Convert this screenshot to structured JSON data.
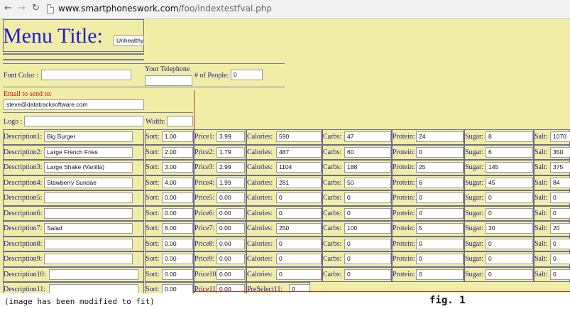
{
  "browser": {
    "url_host": "www.smartphoneswork.com",
    "url_path": "/foo/indextestfval.php"
  },
  "header": {
    "title": "Menu Title:",
    "title_input": "Unhealthy"
  },
  "settings": {
    "font_color_label": "Font Color :",
    "font_color_value": "",
    "telephone_label": "Your Telephone",
    "telephone_value": "",
    "people_label": "# of People:",
    "people_value": "0",
    "email_label": "Email to send to:",
    "email_value": "steve@datatracksoftware.com",
    "logo_label": "Logo :",
    "logo_value": "",
    "width_label": "Width:",
    "width_value": ""
  },
  "rows": [
    {
      "description_label": "Description1:",
      "description": "Big Burger",
      "sort_label": "Sort:",
      "sort": "1.00",
      "price_label": "Price1:",
      "price": "3.99",
      "calories_label": "Calories:",
      "calories": "590",
      "carbs_label": "Carbs:",
      "carbs": "47",
      "protein_label": "Protein:",
      "protein": "24",
      "sugar_label": "Sugar:",
      "sugar": "8",
      "salt_label": "Salt:",
      "salt": "1070"
    },
    {
      "description_label": "Description2:",
      "description": "Large French Fries",
      "sort_label": "Sort:",
      "sort": "2.00",
      "price_label": "Price2:",
      "price": "1.79",
      "calories_label": "Calories:",
      "calories": "487",
      "carbs_label": "Carbs:",
      "carbs": "60",
      "protein_label": "Protein:",
      "protein": "0",
      "sugar_label": "Sugar:",
      "sugar": "6",
      "salt_label": "Salt:",
      "salt": "350"
    },
    {
      "description_label": "Description3:",
      "description": "Large Shake (Vanilla)",
      "sort_label": "Sort:",
      "sort": "3.00",
      "price_label": "Price3:",
      "price": "2.99",
      "calories_label": "Calories:",
      "calories": "1104",
      "carbs_label": "Carbs:",
      "carbs": "188",
      "protein_label": "Protein:",
      "protein": "25",
      "sugar_label": "Sugar:",
      "sugar": "145",
      "salt_label": "Salt:",
      "salt": "375"
    },
    {
      "description_label": "Description4:",
      "description": "Stawberry Sundae",
      "sort_label": "Sort:",
      "sort": "4.00",
      "price_label": "Price4:",
      "price": "1.99",
      "calories_label": "Calories:",
      "calories": "281",
      "carbs_label": "Carbs:",
      "carbs": "50",
      "protein_label": "Protein:",
      "protein": "6",
      "sugar_label": "Sugar:",
      "sugar": "45",
      "salt_label": "Salt:",
      "salt": "84"
    },
    {
      "description_label": "Description5:",
      "description": "",
      "sort_label": "Sort:",
      "sort": "0.00",
      "price_label": "Price5:",
      "price": "0.00",
      "calories_label": "Calories:",
      "calories": "0",
      "carbs_label": "Carbs:",
      "carbs": "0",
      "protein_label": "Protein:",
      "protein": "0",
      "sugar_label": "Sugar:",
      "sugar": "0",
      "salt_label": "Salt:",
      "salt": "0"
    },
    {
      "description_label": "Description6:",
      "description": "",
      "sort_label": "Sort:",
      "sort": "0.00",
      "price_label": "Price6:",
      "price": "0.00",
      "calories_label": "Calories:",
      "calories": "0",
      "carbs_label": "Carbs:",
      "carbs": "0",
      "protein_label": "Protein:",
      "protein": "0",
      "sugar_label": "Sugar:",
      "sugar": "0",
      "salt_label": "Salt:",
      "salt": "0"
    },
    {
      "description_label": "Description7:",
      "description": "Salad",
      "sort_label": "Sort:",
      "sort": "6.00",
      "price_label": "Price7:",
      "price": "0.00",
      "calories_label": "Calories:",
      "calories": "250",
      "carbs_label": "Carbs:",
      "carbs": "100",
      "protein_label": "Protein:",
      "protein": "5",
      "sugar_label": "Sugar:",
      "sugar": "30",
      "salt_label": "Salt:",
      "salt": "20"
    },
    {
      "description_label": "Description8:",
      "description": "",
      "sort_label": "Sort:",
      "sort": "0.00",
      "price_label": "Price8:",
      "price": "0.00",
      "calories_label": "Calories:",
      "calories": "0",
      "carbs_label": "Carbs:",
      "carbs": "0",
      "protein_label": "Protein:",
      "protein": "0",
      "sugar_label": "Sugar:",
      "sugar": "0",
      "salt_label": "Salt:",
      "salt": "0"
    },
    {
      "description_label": "Description9:",
      "description": "",
      "sort_label": "Sort:",
      "sort": "0.00",
      "price_label": "Price9:",
      "price": "0.00",
      "calories_label": "Calories:",
      "calories": "0",
      "carbs_label": "Carbs:",
      "carbs": "0",
      "protein_label": "Protein:",
      "protein": "0",
      "sugar_label": "Sugar:",
      "sugar": "0",
      "salt_label": "Salt:",
      "salt": "0"
    },
    {
      "description_label": "Description10:",
      "description": "",
      "sort_label": "Sort:",
      "sort": "0.00",
      "price_label": "Price10:",
      "price": "0.00",
      "calories_label": "Calories:",
      "calories": "0",
      "carbs_label": "Carbs:",
      "carbs": "0",
      "protein_label": "Protein:",
      "protein": "0",
      "sugar_label": "Sugar:",
      "sugar": "0",
      "salt_label": "Salt:",
      "salt": "0"
    },
    {
      "description_label": "Description11:",
      "description": "",
      "sort_label": "Sort:",
      "sort": "0.00",
      "price_label": "Price11:",
      "price": "0.00",
      "preselect_label": "PreSelect11:",
      "preselect": "0"
    }
  ],
  "caption": {
    "note": "(image has been modified to fit)",
    "figure": "fig. 1"
  }
}
